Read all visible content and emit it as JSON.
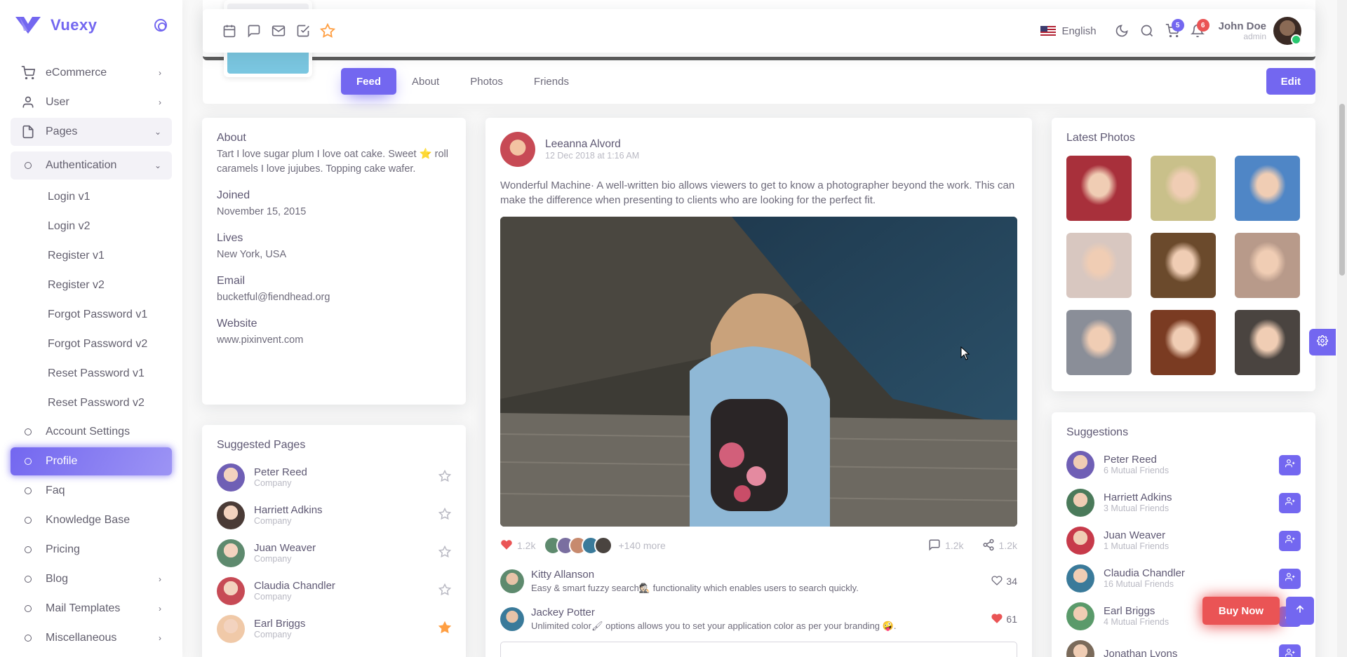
{
  "brand": {
    "name": "Vuexy"
  },
  "nav": {
    "ecommerce": "eCommerce",
    "user": "User",
    "pages": "Pages",
    "authentication": "Authentication",
    "auth_items": [
      "Login v1",
      "Login v2",
      "Register v1",
      "Register v2",
      "Forgot Password v1",
      "Forgot Password v2",
      "Reset Password v1",
      "Reset Password v2"
    ],
    "account_settings": "Account Settings",
    "profile": "Profile",
    "faq": "Faq",
    "knowledge_base": "Knowledge Base",
    "pricing": "Pricing",
    "blog": "Blog",
    "mail_templates": "Mail Templates",
    "miscellaneous": "Miscellaneous"
  },
  "topbar": {
    "language": "English",
    "cart_count": "5",
    "notif_count": "6",
    "user_name": "John Doe",
    "user_role": "admin"
  },
  "profile": {
    "tabs": [
      "Feed",
      "About",
      "Photos",
      "Friends"
    ],
    "edit": "Edit"
  },
  "about": {
    "title": "About",
    "bio": "Tart I love sugar plum I love oat cake. Sweet ⭐ roll caramels I love jujubes. Topping cake wafer.",
    "joined_label": "Joined",
    "joined": "November 15, 2015",
    "lives_label": "Lives",
    "lives": "New York, USA",
    "email_label": "Email",
    "email": "bucketful@fiendhead.org",
    "website_label": "Website",
    "website": "www.pixinvent.com"
  },
  "suggested_pages": {
    "title": "Suggested Pages",
    "items": [
      {
        "name": "Peter Reed",
        "sub": "Company",
        "starred": false,
        "color": "#6f5fb5"
      },
      {
        "name": "Harriett Adkins",
        "sub": "Company",
        "starred": false,
        "color": "#4a3b36"
      },
      {
        "name": "Juan Weaver",
        "sub": "Company",
        "starred": false,
        "color": "#5e8a6e"
      },
      {
        "name": "Claudia Chandler",
        "sub": "Company",
        "starred": false,
        "color": "#c74a55"
      },
      {
        "name": "Earl Briggs",
        "sub": "Company",
        "starred": true,
        "color": "#f0c9a8"
      }
    ]
  },
  "post": {
    "author": "Leeanna Alvord",
    "time": "12 Dec 2018 at 1:16 AM",
    "body": "Wonderful Machine· A well-written bio allows viewers to get to know a photographer beyond the work. This can make the difference when presenting to clients who are looking for the perfect fit.",
    "likes": "1.2k",
    "more": "+140 more",
    "comments": "1.2k",
    "shares": "1.2k",
    "comments_list": [
      {
        "name": "Kitty Allanson",
        "body": "Easy & smart fuzzy search🕵🏻 functionality which enables users to search quickly.",
        "likes": "34",
        "liked": false
      },
      {
        "name": "Jackey Potter",
        "body": "Unlimited color🖌 options allows you to set your application color as per your branding 🤪.",
        "likes": "61",
        "liked": true
      }
    ]
  },
  "latest_photos": {
    "title": "Latest Photos",
    "colors": [
      "#a8303b",
      "#c9c08a",
      "#4f86c6",
      "#d8c7c0",
      "#6b4a2c",
      "#b89a8a",
      "#8a8e98",
      "#7a3b22",
      "#4a4440"
    ]
  },
  "suggestions": {
    "title": "Suggestions",
    "items": [
      {
        "name": "Peter Reed",
        "sub": "6 Mutual Friends",
        "color": "#6f5fb5"
      },
      {
        "name": "Harriett Adkins",
        "sub": "3 Mutual Friends",
        "color": "#4a7a5a"
      },
      {
        "name": "Juan Weaver",
        "sub": "1 Mutual Friends",
        "color": "#c73a4a"
      },
      {
        "name": "Claudia Chandler",
        "sub": "16 Mutual Friends",
        "color": "#3a7a9a"
      },
      {
        "name": "Earl Briggs",
        "sub": "4 Mutual Friends",
        "color": "#5a9a6a"
      },
      {
        "name": "Jonathan Lyons",
        "sub": "",
        "color": "#7a6a5a"
      }
    ]
  },
  "buy_now": "Buy Now",
  "colors": {
    "primary": "#7367f0",
    "danger": "#ea5455",
    "success": "#28c76f",
    "warning": "#ff9f43"
  }
}
